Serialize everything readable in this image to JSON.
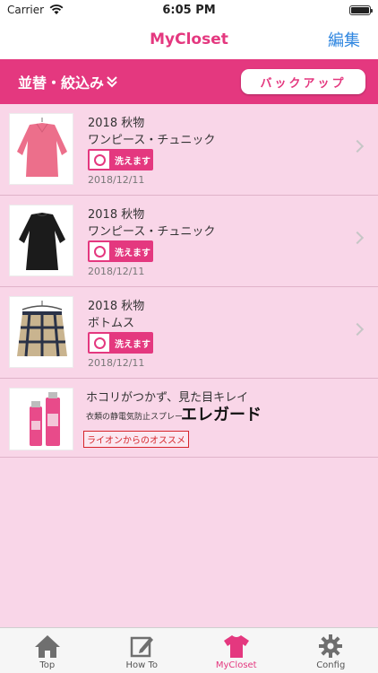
{
  "status": {
    "carrier": "Carrier",
    "time": "6:05 PM"
  },
  "nav": {
    "title": "MyCloset",
    "edit": "編集"
  },
  "filter": {
    "sort_label": "並替・絞込み",
    "backup_label": "バックアップ"
  },
  "items": [
    {
      "season": "2018 秋物",
      "category": "ワンピース・チュニック",
      "wash": "洗えます",
      "date": "2018/12/11",
      "image": "pink-tunic"
    },
    {
      "season": "2018 秋物",
      "category": "ワンピース・チュニック",
      "wash": "洗えます",
      "date": "2018/12/11",
      "image": "black-dress"
    },
    {
      "season": "2018 秋物",
      "category": "ボトムス",
      "wash": "洗えます",
      "date": "2018/12/11",
      "image": "plaid-skirt"
    }
  ],
  "ad": {
    "title": "ホコリがつかず、見た目キレイ",
    "sub": "衣類の静電気防止スプレー",
    "brand": "エレガード",
    "tag": "ライオンからのオススメ"
  },
  "tabs": [
    {
      "label": "Top",
      "icon": "house-icon",
      "active": false
    },
    {
      "label": "How To",
      "icon": "pencil-note-icon",
      "active": false
    },
    {
      "label": "MyCloset",
      "icon": "tshirt-icon",
      "active": true
    },
    {
      "label": "Config",
      "icon": "gear-icon",
      "active": false
    }
  ],
  "colors": {
    "accent": "#e4387f",
    "background": "#f9d6e8",
    "link": "#2f86e0"
  }
}
